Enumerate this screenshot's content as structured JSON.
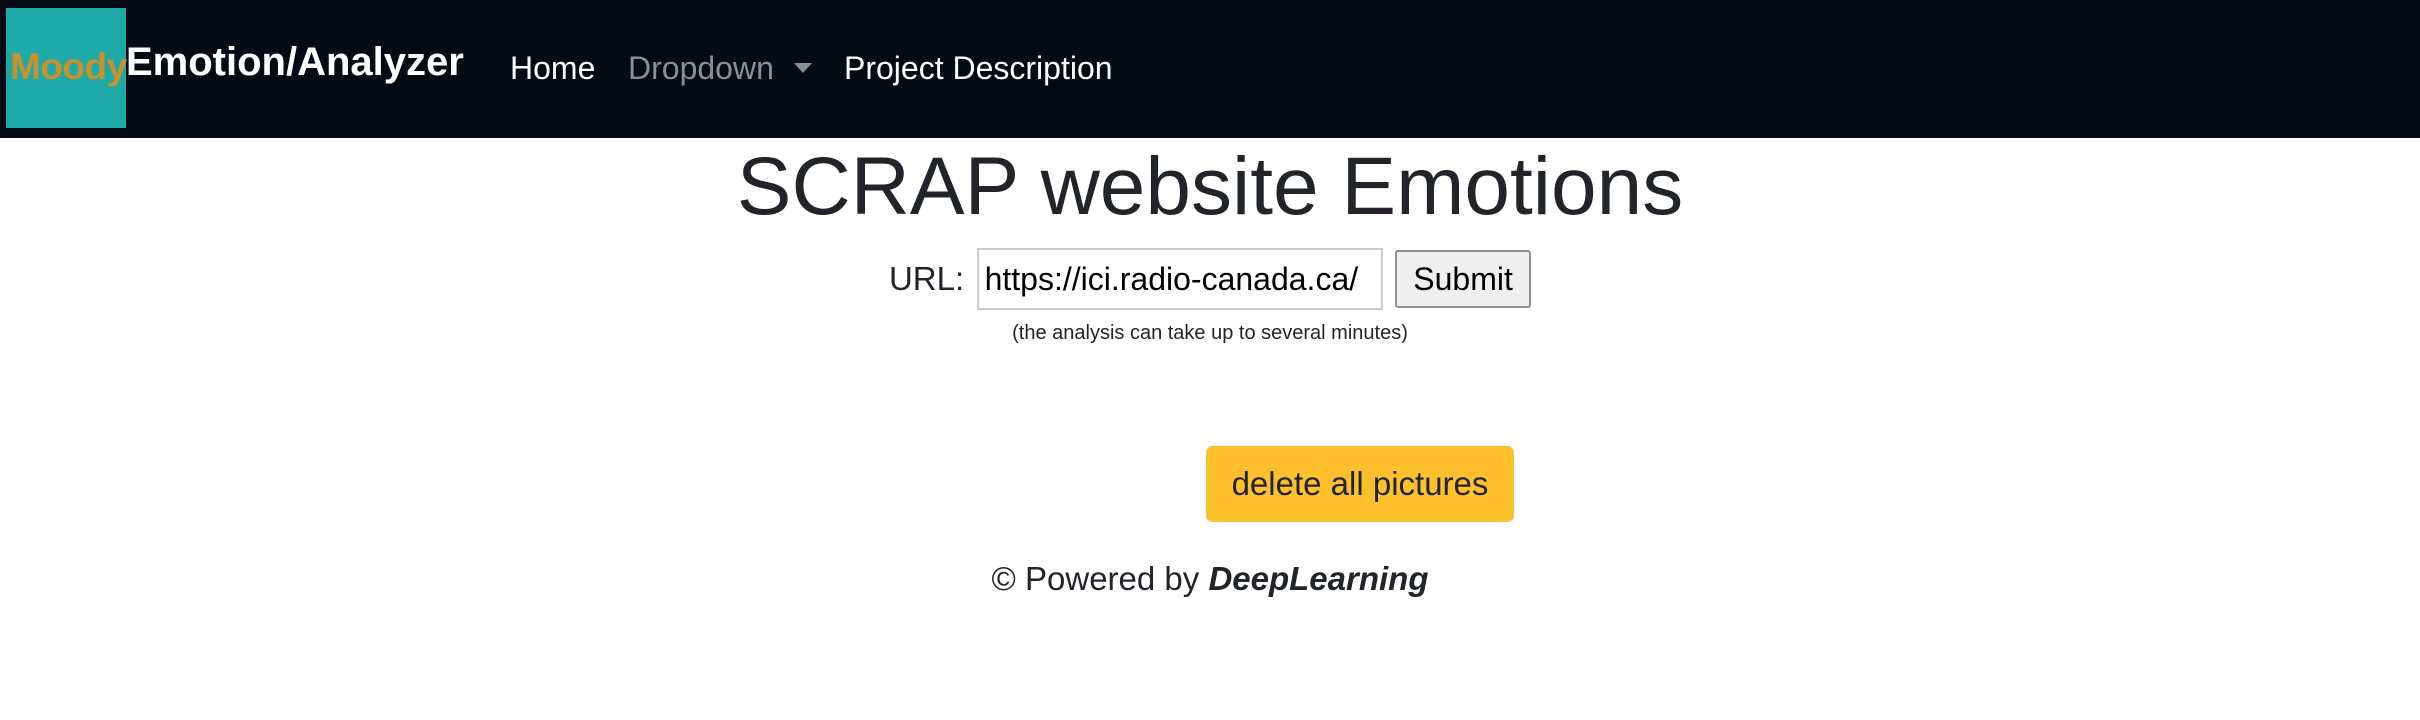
{
  "navbar": {
    "logo_text": "Moody",
    "brand": "Emotion/Analyzer",
    "links": {
      "home": "Home",
      "dropdown": "Dropdown",
      "project": "Project Description"
    }
  },
  "main": {
    "title": "SCRAP website Emotions",
    "url_label": "URL:",
    "url_value": "https://ici.radio-canada.ca/",
    "submit_label": "Submit",
    "hint": "(the analysis can take up to several minutes)",
    "delete_label": "delete all pictures"
  },
  "footer": {
    "prefix": "© Powered by ",
    "brand": "DeepLearning"
  },
  "colors": {
    "navbar_bg": "#040b14",
    "logo_bg": "#1eaaa8",
    "logo_text": "#c9902c",
    "delete_button": "#ffc02d"
  },
  "icons": {
    "dropdown": "caret-down-icon"
  }
}
